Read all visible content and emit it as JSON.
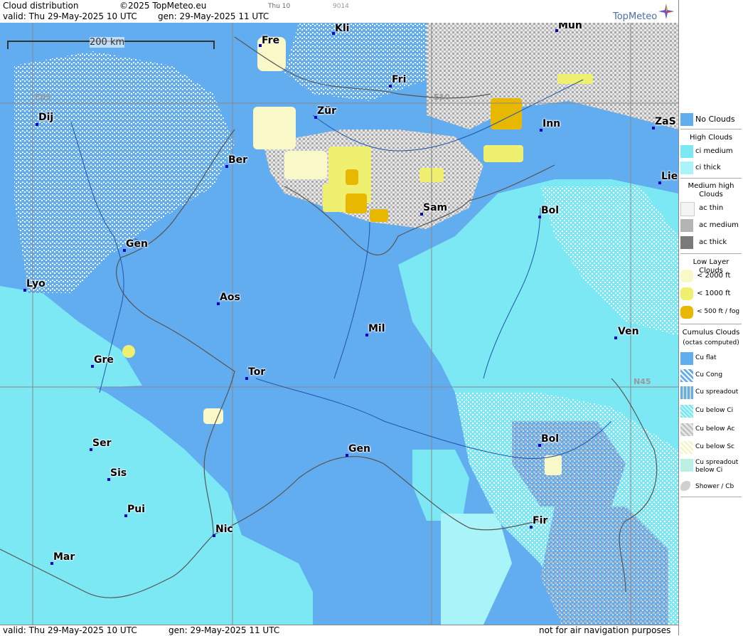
{
  "header": {
    "product": "Cloud distribution",
    "copyright": "©2025 TopMeteo.eu",
    "valid_line": "valid:  Thu  29-May-2025  10 UTC",
    "gen_line": "gen: 29-May-2025 11 UTC",
    "small_a": "Thu 10",
    "small_b": "9014",
    "logo_text": "TopMeteo"
  },
  "map": {
    "scale_label": "200 km",
    "grid_labels": {
      "e05": "E05",
      "e10": "E10",
      "n45": "N45"
    },
    "cities": [
      {
        "name": "Fre"
      },
      {
        "name": "Kli"
      },
      {
        "name": "Mün"
      },
      {
        "name": "Fri"
      },
      {
        "name": "Dij"
      },
      {
        "name": "Zür"
      },
      {
        "name": "Inn"
      },
      {
        "name": "ZaS"
      },
      {
        "name": "Ber"
      },
      {
        "name": "Lie"
      },
      {
        "name": "Sam"
      },
      {
        "name": "Bol"
      },
      {
        "name": "Gen"
      },
      {
        "name": "Lyo"
      },
      {
        "name": "Aos"
      },
      {
        "name": "Mil"
      },
      {
        "name": "Ven"
      },
      {
        "name": "Gre"
      },
      {
        "name": "Tor"
      },
      {
        "name": "Ser"
      },
      {
        "name": "Gen"
      },
      {
        "name": "Bol"
      },
      {
        "name": "Sis"
      },
      {
        "name": "Pui"
      },
      {
        "name": "Nic"
      },
      {
        "name": "Fir"
      },
      {
        "name": "Mar"
      }
    ]
  },
  "legend": {
    "no_clouds": {
      "label": "No Clouds",
      "color": "#62acf0"
    },
    "high_head": "High Clouds",
    "high": [
      {
        "label": "ci medium",
        "color": "#7be8f4"
      },
      {
        "label": "ci thick",
        "color": "#a8f4f8"
      }
    ],
    "mid_head": "Medium high Clouds",
    "mid": [
      {
        "label": "ac thin",
        "color": "#f4f4f4"
      },
      {
        "label": "ac medium",
        "color": "#b4b4b4"
      },
      {
        "label": "ac thick",
        "color": "#7a7a7a"
      }
    ],
    "low_head": "Low Layer Clouds",
    "low": [
      {
        "label": "< 2000 ft",
        "color": "#f8f8c8"
      },
      {
        "label": "< 1000 ft",
        "color": "#f0f070"
      },
      {
        "label": "< 500 ft / fog",
        "color": "#e8b800"
      }
    ],
    "cu_head": "Cumulus Clouds",
    "cu_sub": "(octas computed)",
    "cu": [
      {
        "label": "Cu flat",
        "color": "#62acf0"
      },
      {
        "label": "Cu Cong",
        "color": "#62acf0"
      },
      {
        "label": "Cu spreadout",
        "color": "#62acf0"
      },
      {
        "label": "Cu below Ci",
        "color": "#7be8f4"
      },
      {
        "label": "Cu below Ac",
        "color": "#e6e6e6"
      },
      {
        "label": "Cu below Sc",
        "color": "#f4f4c8"
      },
      {
        "label": "Cu spreadout below Ci",
        "color": "#a8f4f8"
      },
      {
        "label": "Shower / Cb",
        "color": "#d0d0d0"
      }
    ]
  },
  "footer": {
    "valid_line": "valid:  Thu  29-May-2025  10 UTC",
    "gen_line": "gen: 29-May-2025 11 UTC",
    "notice": "not for air navigation purposes"
  }
}
